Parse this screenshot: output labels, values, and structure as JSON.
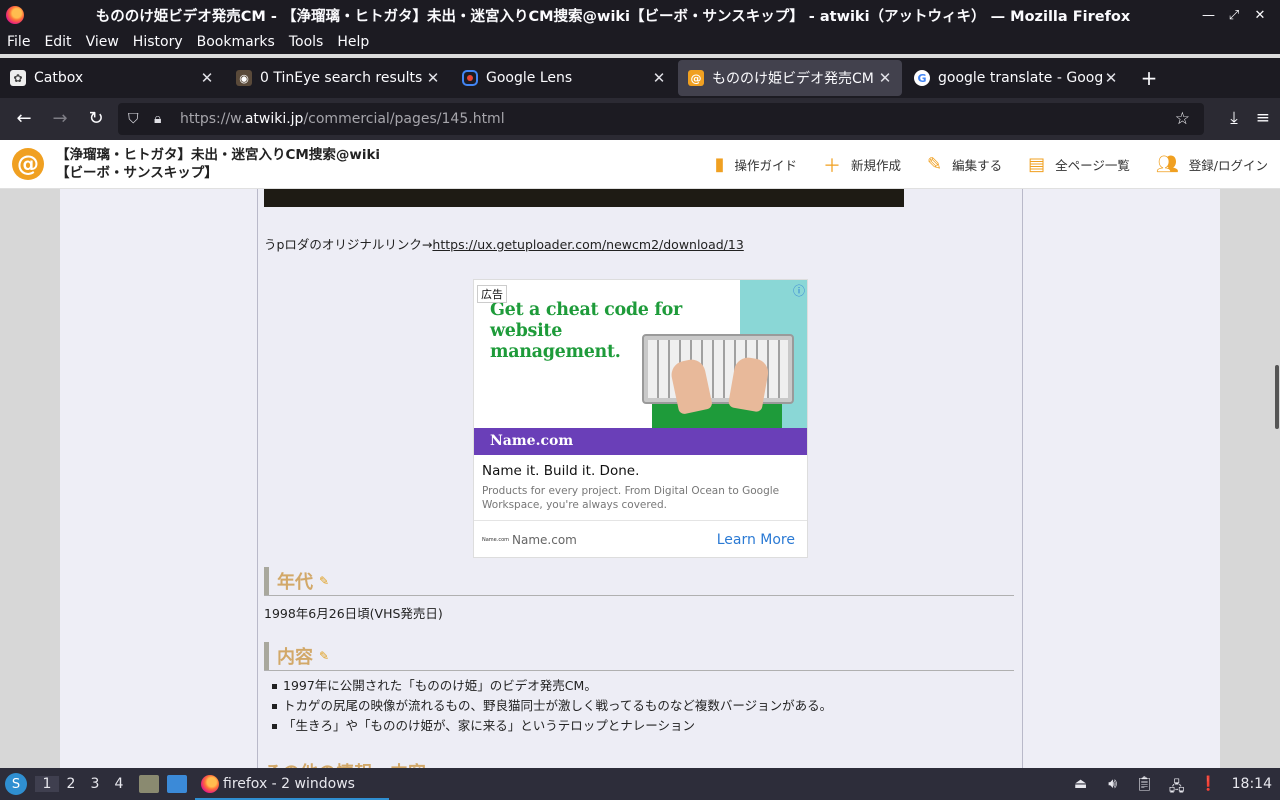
{
  "window": {
    "title": "もののけ姫ビデオ発売CM - 【浄瑠璃・ヒトガタ】未出・迷宮入りCM捜索@wiki【ビーボ・サンスキップ】 - atwiki（アットウィキ） — Mozilla Firefox"
  },
  "menu": [
    "File",
    "Edit",
    "View",
    "History",
    "Bookmarks",
    "Tools",
    "Help"
  ],
  "tabs": [
    {
      "label": "Catbox",
      "icon": "catbox-icon"
    },
    {
      "label": "0 TinEye search results",
      "icon": "tineye-icon"
    },
    {
      "label": "Google Lens",
      "icon": "google-lens-icon"
    },
    {
      "label": "もののけ姫ビデオ発売CM - ",
      "icon": "atwiki-icon",
      "active": true
    },
    {
      "label": "google translate - Google",
      "icon": "google-icon"
    }
  ],
  "url": {
    "prefix": "https://w.",
    "domain": "atwiki.jp",
    "path": "/commercial/pages/145.html"
  },
  "site": {
    "title_line1": "【浄瑠璃・ヒトガタ】未出・迷宮入りCM捜索@wiki",
    "title_line2": "【ビーボ・サンスキップ】",
    "nav": [
      "操作ガイド",
      "新規作成",
      "編集する",
      "全ページ一覧",
      "登録/ログイン"
    ]
  },
  "content": {
    "download_prefix": "うpロダのオリジナルリンク→",
    "download_link": "https://ux.getuploader.com/newcm2/download/13",
    "ad": {
      "badge": "広告",
      "headline": "Get a cheat code for website management.",
      "brand_banner": "Name.com",
      "tagline": "Name it. Build it. Done.",
      "description": "Products for every project. From Digital Ocean to Google Workspace, you're always covered.",
      "footer_mini": "Name.com",
      "footer_brand": "Name.com",
      "cta": "Learn More"
    },
    "section1": {
      "heading": "年代",
      "text": "1998年6月26日頃(VHS発売日)"
    },
    "section2": {
      "heading": "内容",
      "items": [
        "1997年に公開された「もののけ姫」のビデオ発売CM。",
        "トカゲの尻尾の映像が流れるもの、野良猫同士が激しく戦ってるものなど複数バージョンがある。",
        "「生きろ」や「もののけ姫が、家に来る」というテロップとナレーション"
      ]
    },
    "section3_partial": "その他の情報・内容"
  },
  "taskbar": {
    "workspaces": [
      "1",
      "2",
      "3",
      "4"
    ],
    "task_label": "firefox - 2 windows",
    "clock": "18:14"
  }
}
